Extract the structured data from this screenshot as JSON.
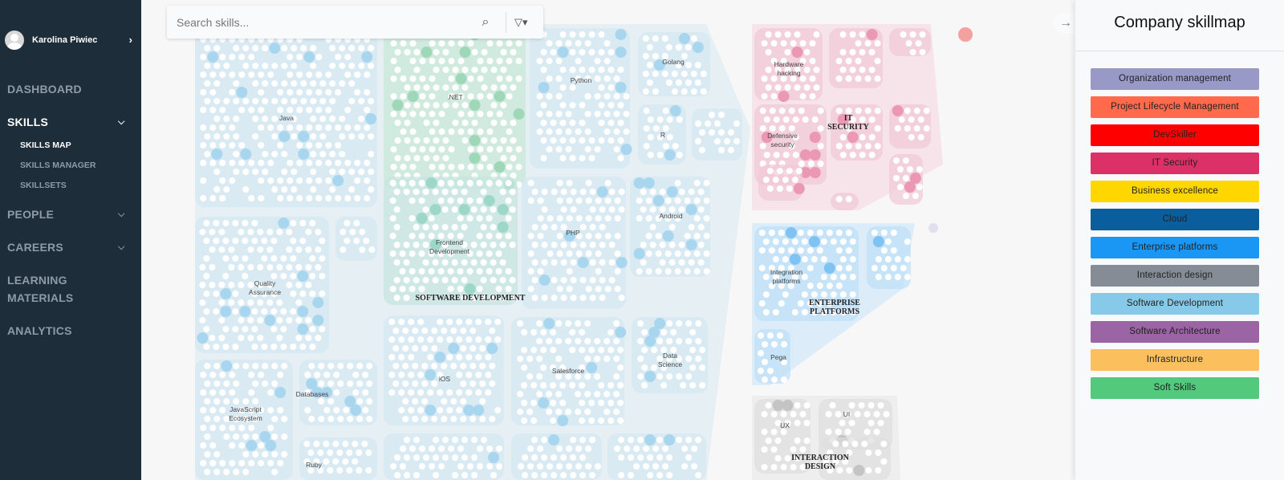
{
  "user": {
    "name": "Karolina Piwiec"
  },
  "nav": {
    "dashboard": "DASHBOARD",
    "skills": "SKILLS",
    "skills_map": "SKILLS MAP",
    "skills_manager": "SKILLS MANAGER",
    "skillsets": "SKILLSETS",
    "people": "PEOPLE",
    "careers": "CAREERS",
    "learning1": "LEARNING",
    "learning2": "MATERIALS",
    "analytics": "ANALYTICS"
  },
  "search": {
    "placeholder": "Search skills..."
  },
  "panel": {
    "title": "Company skillmap",
    "legend": [
      {
        "label": "Organization management",
        "color": "#9999c8"
      },
      {
        "label": "Project Lifecycle Management",
        "color": "#ff6a4d"
      },
      {
        "label": "DevSkiller",
        "color": "#ff0000"
      },
      {
        "label": "IT Security",
        "color": "#dc3167"
      },
      {
        "label": "Business excellence",
        "color": "#ffd600"
      },
      {
        "label": "Cloud",
        "color": "#0b5e9e"
      },
      {
        "label": "Enterprise platforms",
        "color": "#1a96f5"
      },
      {
        "label": "Interaction design",
        "color": "#868c96"
      },
      {
        "label": "Software Development",
        "color": "#86c9e8"
      },
      {
        "label": "Software Architecture",
        "color": "#9b64a4"
      },
      {
        "label": "Infrastructure",
        "color": "#fbbf5e"
      },
      {
        "label": "Soft Skills",
        "color": "#52c97c"
      }
    ]
  },
  "map": {
    "sections": [
      "SOFTWARE DEVELOPMENT",
      "IT SECURITY",
      "ENTERPRISE PLATFORMS",
      "INTERACTION DESIGN"
    ],
    "clusters": [
      "Java",
      ".NET",
      "Python",
      "Golang",
      "R",
      "Quality Assurance",
      "Frontend Development",
      "PHP",
      "Android",
      "iOS",
      "Salesforce",
      "Data Science",
      "JavaScript Ecosystem",
      "Databases",
      "Ruby",
      "Hardware hacking",
      "Defensive security",
      "Integration platforms",
      "Pega",
      "UX",
      "UI"
    ]
  }
}
